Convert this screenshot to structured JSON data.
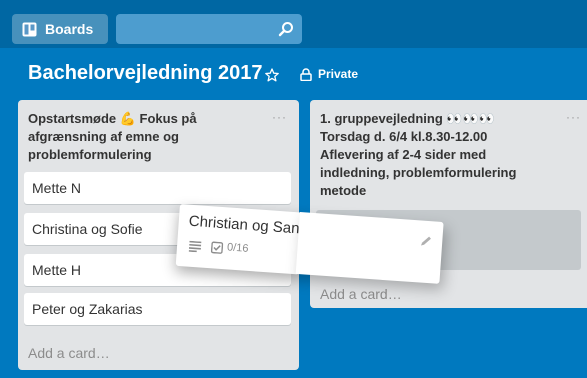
{
  "header": {
    "boards_label": "Boards"
  },
  "board": {
    "title": "Bachelorvejledning 2017",
    "visibility": "Private"
  },
  "lists": [
    {
      "title": "Opstartsmøde 💪 Fokus på afgrænsning af emne og problemformulering",
      "menu": "···",
      "cards": [
        "Mette N",
        "Christina og Sofie",
        "Mette H",
        "Peter og Zakarias"
      ],
      "add_card": "Add a card…"
    },
    {
      "title": "1. gruppevejledning 👀👀👀 Torsdag d. 6/4 kl.8.30-12.00 Aflevering af 2-4 sider med indledning, problemformulering metode",
      "menu": "···",
      "add_card": "Add a card…"
    }
  ],
  "dragging_card": {
    "title": "Christian og Sang",
    "checklist": "0/16"
  },
  "colors": {
    "board_bg": "#0079bf",
    "topbar_bg": "#0067a3",
    "list_bg": "#e2e4e6"
  }
}
